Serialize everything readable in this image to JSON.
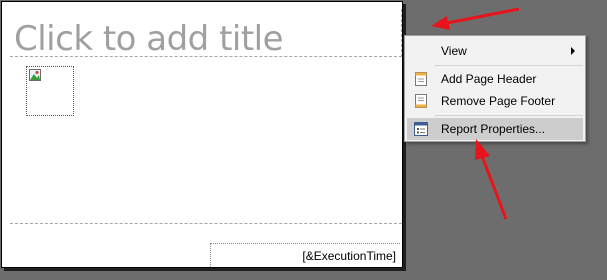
{
  "report": {
    "title_placeholder": "Click to add title",
    "footer_expression": "[&ExecutionTime]"
  },
  "context_menu": {
    "items": [
      {
        "label": "View",
        "icon": "none",
        "has_submenu": true
      },
      {
        "label": "Add Page Header",
        "icon": "page-header-icon"
      },
      {
        "label": "Remove Page Footer",
        "icon": "page-footer-icon"
      },
      {
        "label": "Report Properties...",
        "icon": "report-properties-icon",
        "highlighted": true
      }
    ]
  },
  "colors": {
    "background": "#6d6d6d",
    "arrow": "#e8141c",
    "menu_highlight": "#cdcdcd"
  }
}
